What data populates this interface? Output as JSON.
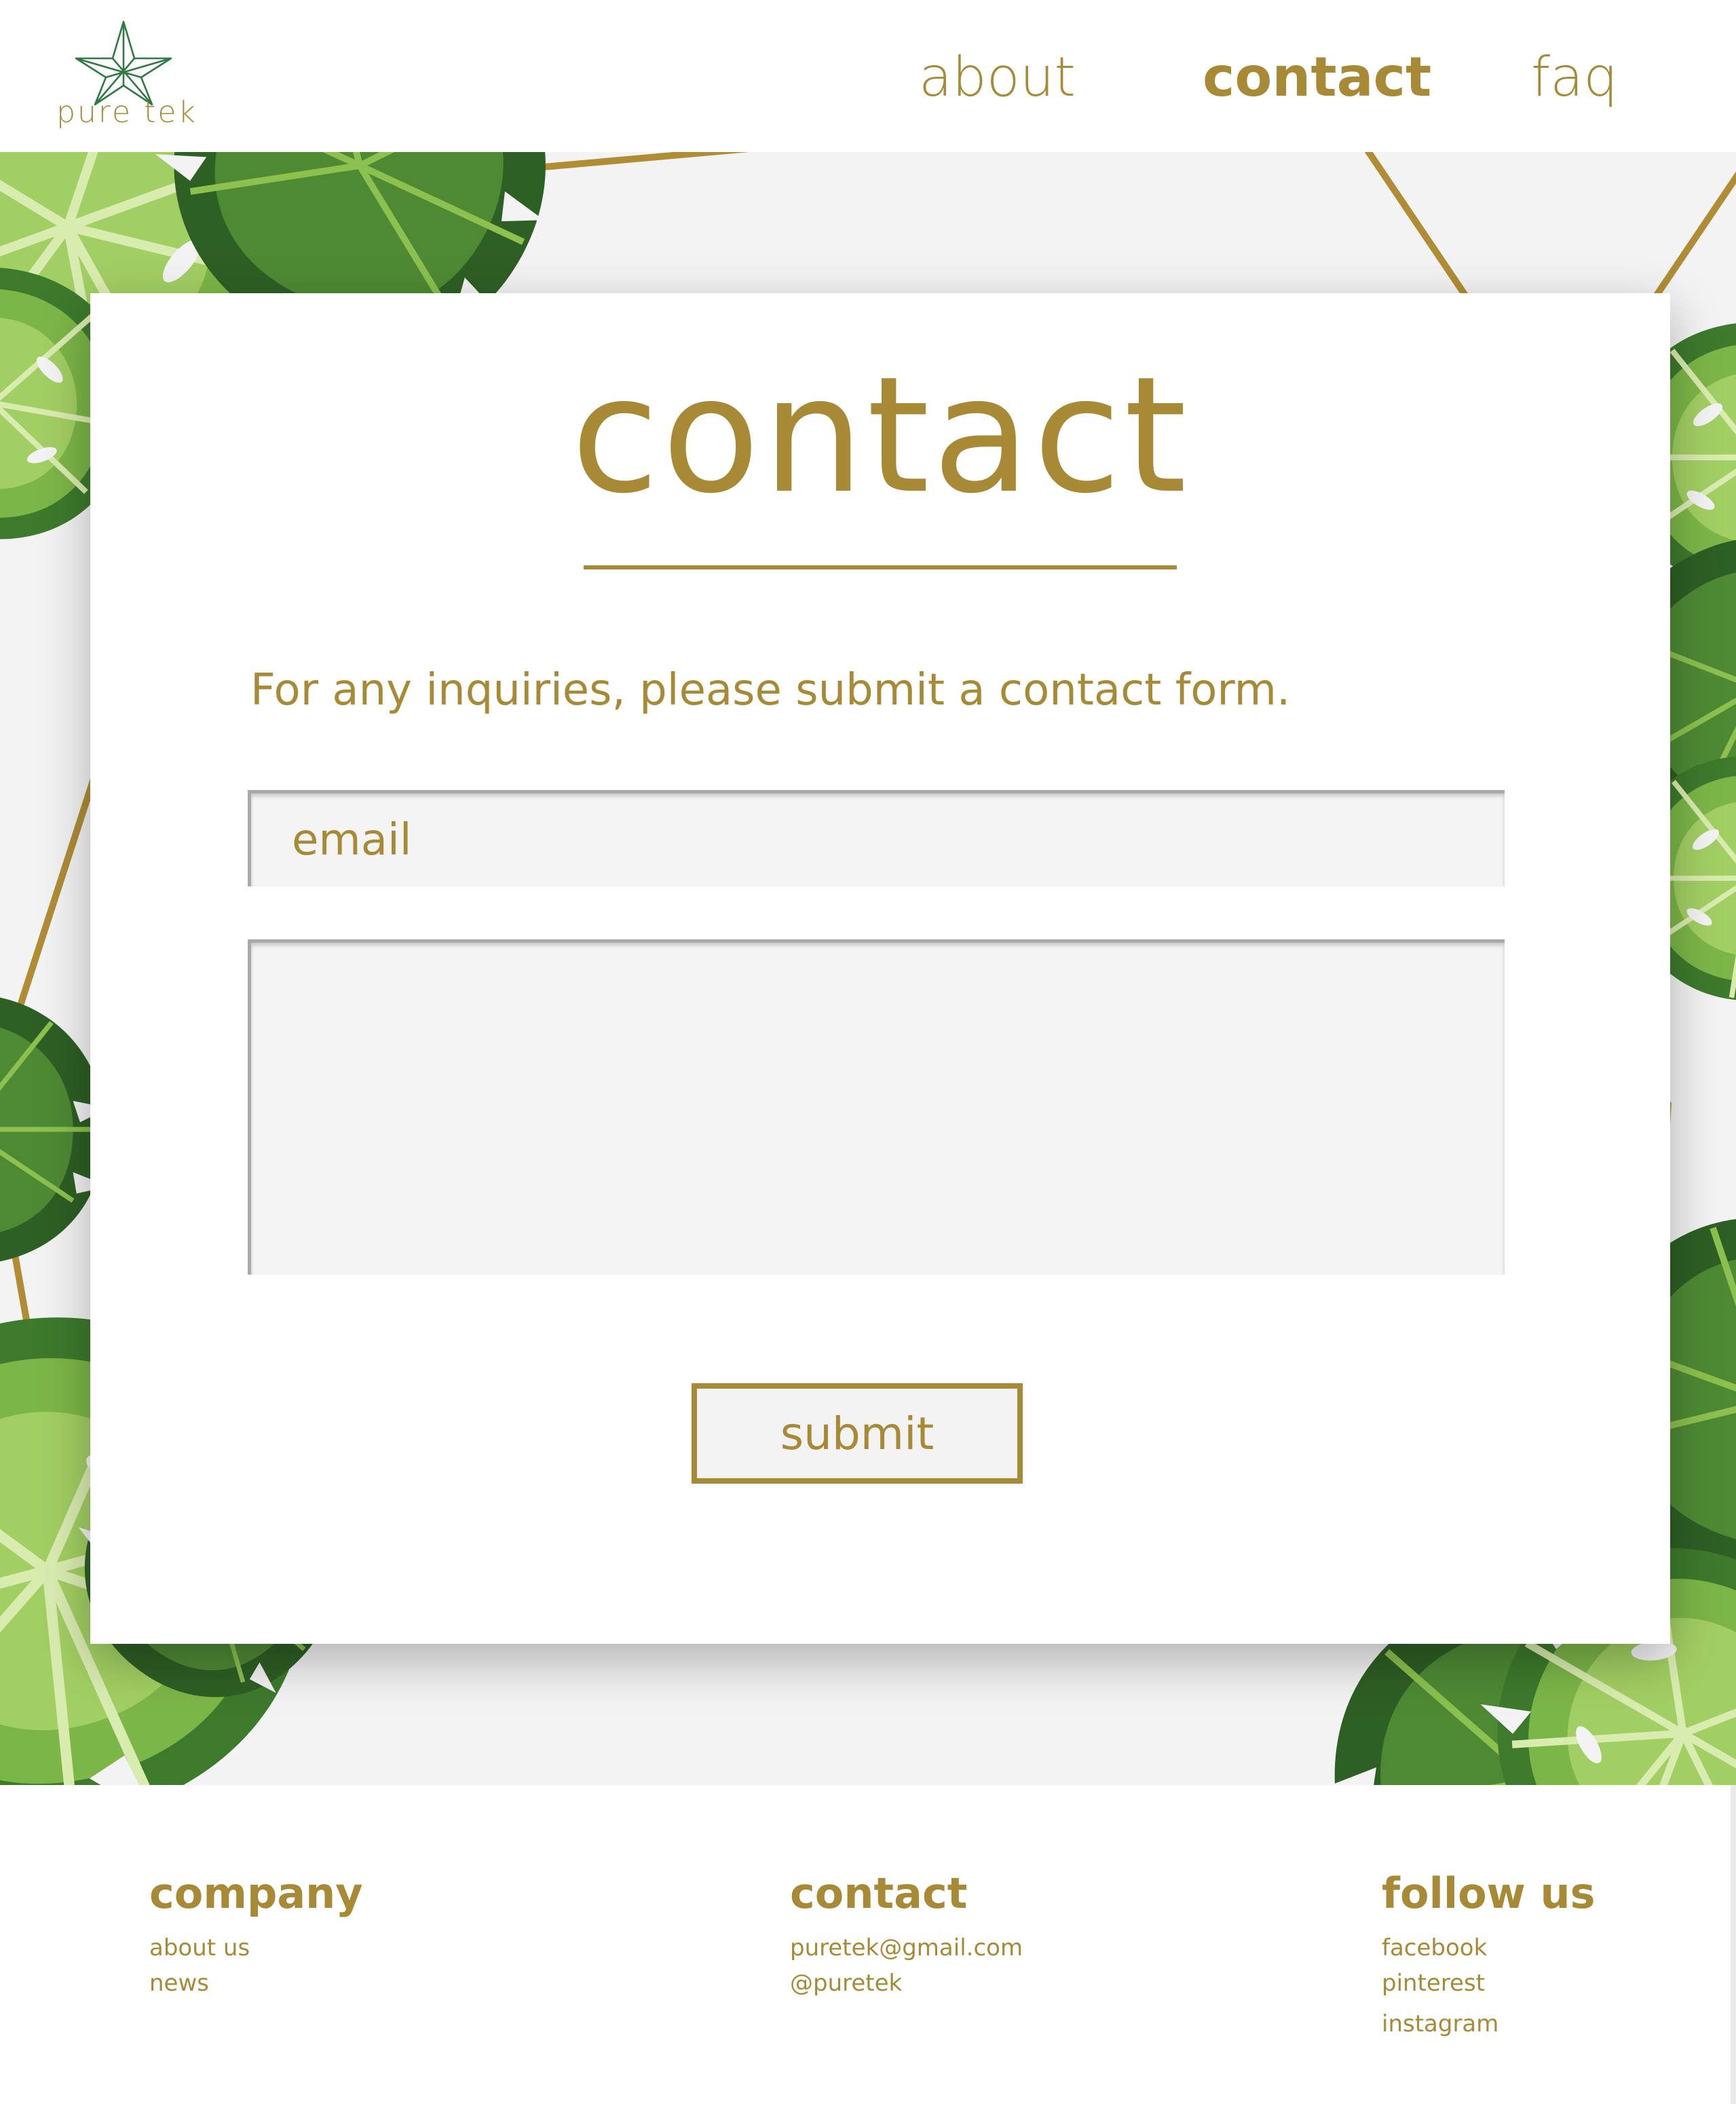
{
  "brand": {
    "logo_text": "pure tek",
    "logo_icon": "cannabis-leaf-star-icon"
  },
  "nav": {
    "items": [
      {
        "label": "about"
      },
      {
        "label": "contact",
        "active": true
      },
      {
        "label": "faq"
      }
    ]
  },
  "hero": {
    "background_art": "monstera-leaves-and-gold-geometric-lines",
    "card": {
      "title": "contact",
      "intro": "For any inquiries, please submit a contact form.",
      "email_placeholder": "email",
      "message_value": "",
      "submit_label": "submit"
    }
  },
  "footer": {
    "columns": [
      {
        "heading": "company",
        "links": [
          "about us",
          "news"
        ]
      },
      {
        "heading": "contact",
        "links": [
          "puretek@gmail.com",
          "@puretek"
        ]
      },
      {
        "heading": "follow us",
        "links": [
          "facebook",
          "pinterest",
          "instagram"
        ]
      }
    ]
  },
  "colors": {
    "accent": "#a88a36",
    "leaf_dark": "#2f6a2a",
    "leaf_mid": "#4f8c34",
    "leaf_light": "#8cc04f",
    "background": "#f3f3f3"
  }
}
